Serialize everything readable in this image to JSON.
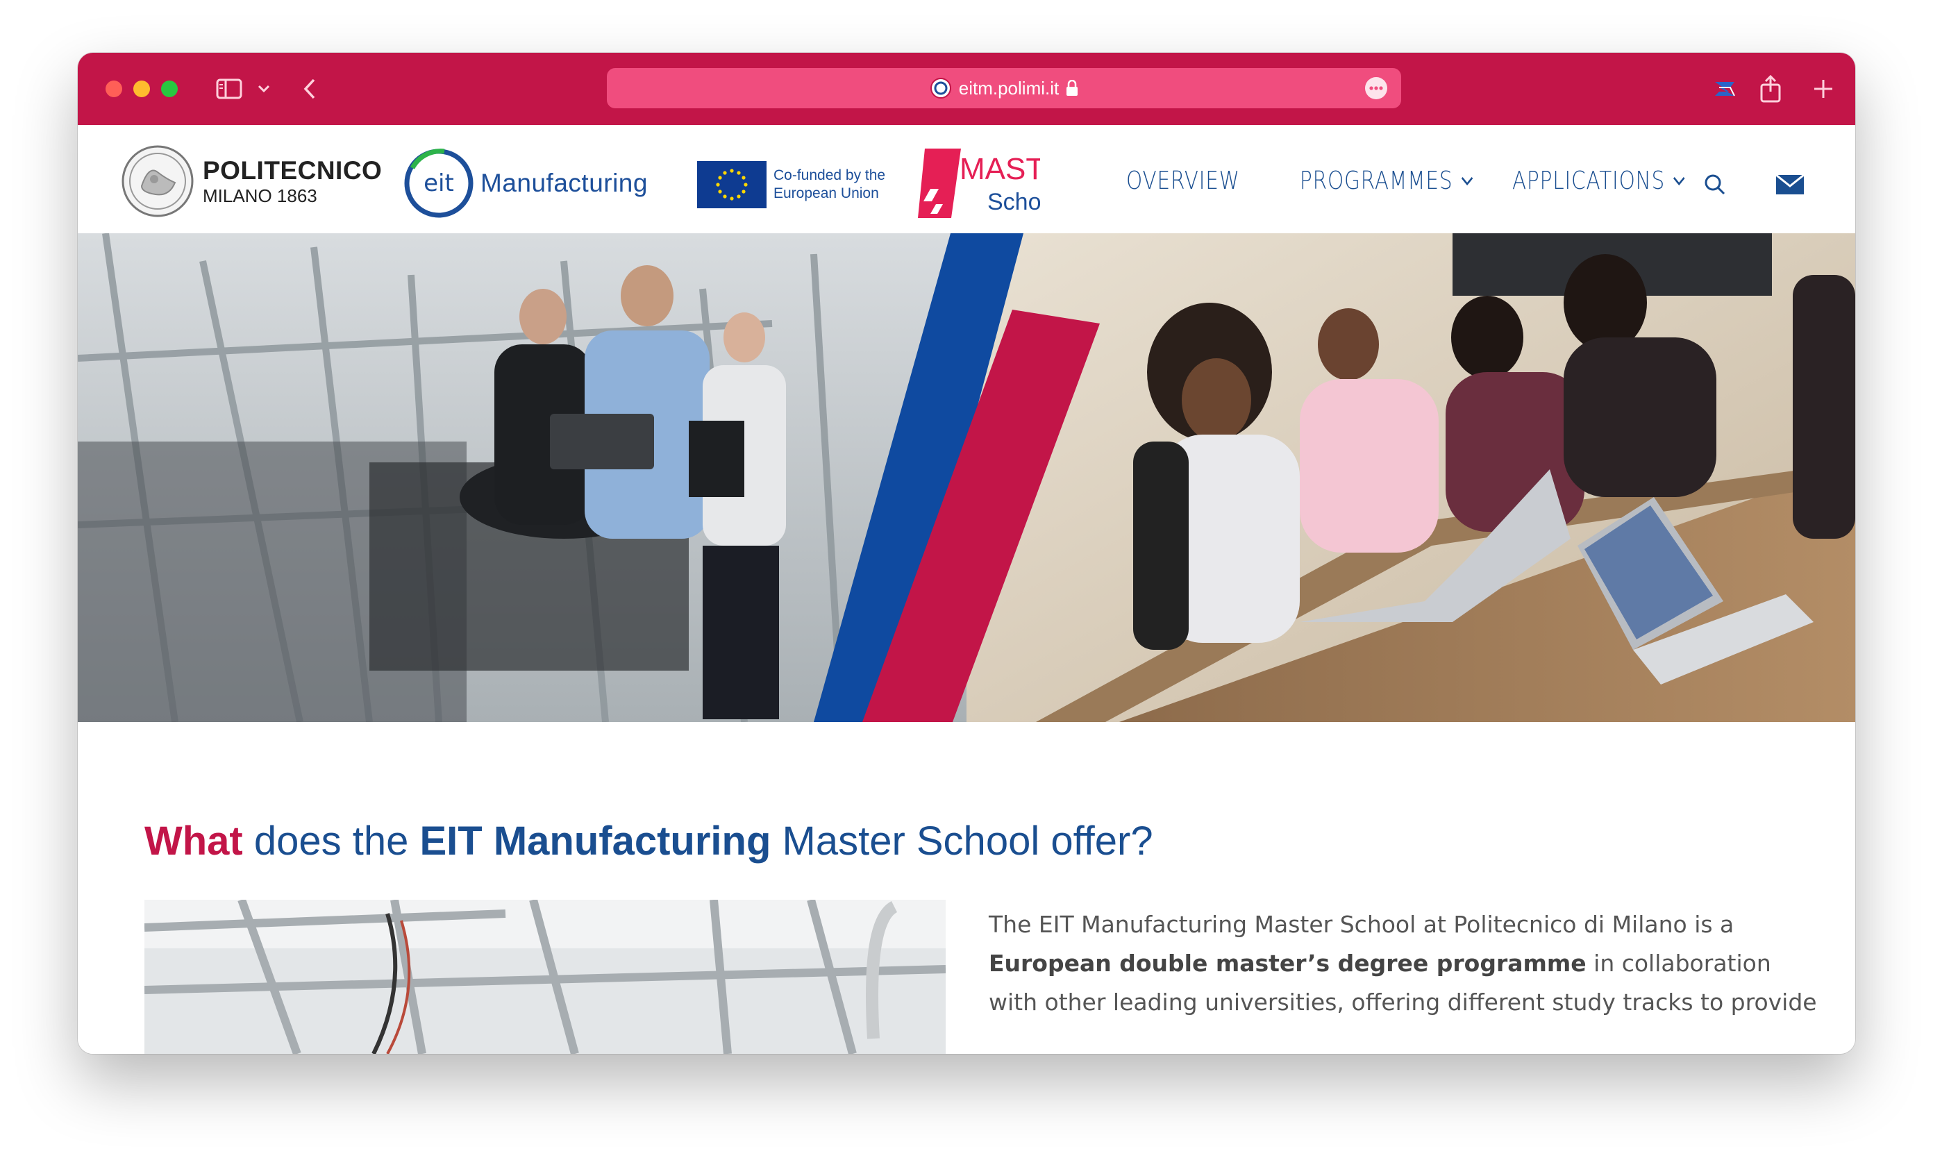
{
  "browser": {
    "url": "eitm.polimi.it",
    "colors": {
      "chrome": "#c21548",
      "address_bar": "#f04d7e"
    }
  },
  "header": {
    "polimi_logo": {
      "name": "POLITECNICO",
      "sub": "MILANO 1863"
    },
    "eit_logo": {
      "mark": "eit",
      "word": "Manufacturing"
    },
    "eu_logo": {
      "line1": "Co-funded by the",
      "line2": "European Union"
    },
    "master_logo": {
      "line1": "MASTER",
      "line2": "School"
    },
    "nav": [
      {
        "label": "OVERVIEW",
        "has_dropdown": false
      },
      {
        "label": "PROGRAMMES",
        "has_dropdown": true
      },
      {
        "label": "APPLICATIONS",
        "has_dropdown": true
      }
    ],
    "icons": [
      "search-icon",
      "mail-icon"
    ],
    "colors": {
      "nav_text": "#1a4e90",
      "brand_red": "#c21548",
      "brand_blue": "#0f4aa0"
    }
  },
  "main": {
    "headline": {
      "part1": "What",
      "part2": " does the ",
      "part3": "EIT Manufacturing",
      "part4": " Master School offer?"
    },
    "body": {
      "text1": "The EIT Manufacturing Master School at Politecnico di Milano is a ",
      "bold": "European double master’s degree programme",
      "text2": " in collaboration with other leading universities, offering different study tracks to provide"
    }
  }
}
